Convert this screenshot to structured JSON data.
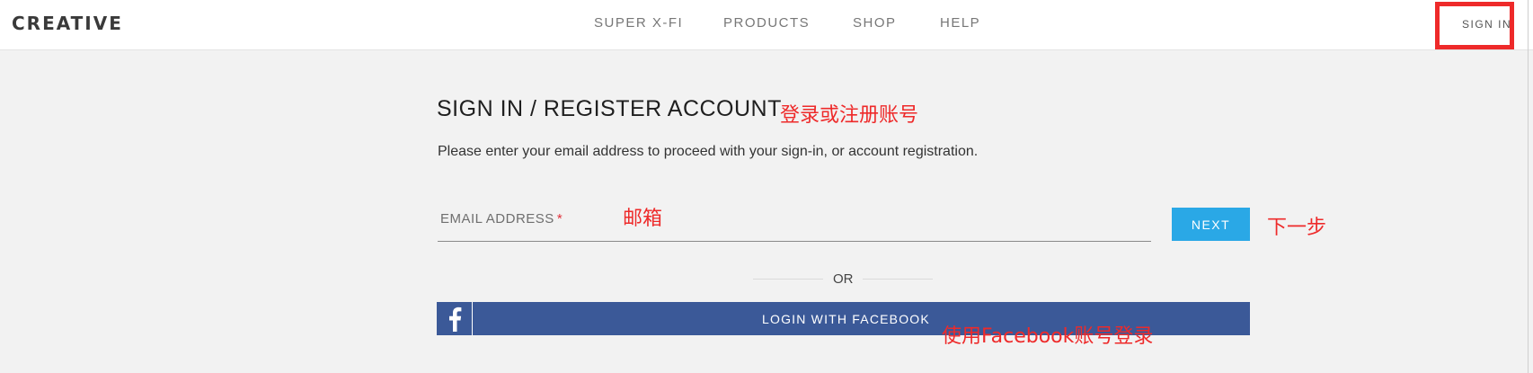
{
  "brand": {
    "logo": "CREATIVE"
  },
  "nav": {
    "items": [
      {
        "label": "SUPER X-FI"
      },
      {
        "label": "PRODUCTS"
      },
      {
        "label": "SHOP"
      },
      {
        "label": "HELP"
      }
    ],
    "signin_label": "SIGN IN"
  },
  "page": {
    "title": "SIGN IN / REGISTER ACCOUNT",
    "subtitle": "Please enter your email address to proceed with your sign-in, or account registration.",
    "email_label": "EMAIL ADDRESS",
    "required_mark": "*",
    "email_value": "",
    "next_label": "NEXT",
    "or_label": "OR",
    "facebook_label": "LOGIN WITH FACEBOOK"
  },
  "annotations": {
    "title": "登录或注册账号",
    "email": "邮箱",
    "next": "下一步",
    "facebook": "使用Facebook账号登录"
  },
  "colors": {
    "accent": "#2aa8e6",
    "facebook": "#3b5998",
    "annotation": "#ee2a2a",
    "background": "#f2f2f2"
  }
}
